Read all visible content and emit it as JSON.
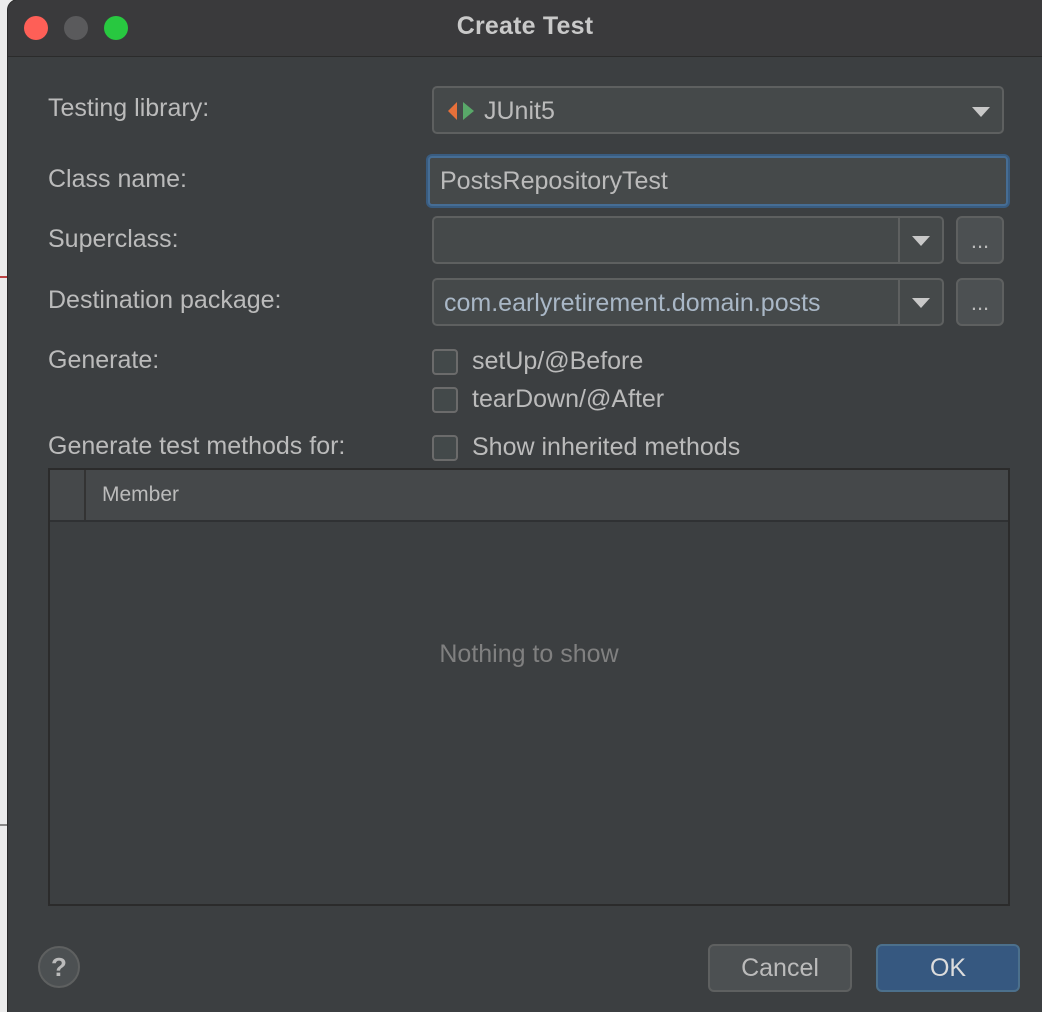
{
  "window": {
    "title": "Create Test"
  },
  "form": {
    "testing_library": {
      "label": "Testing library:",
      "value": "JUnit5",
      "icon": "junit-icon"
    },
    "class_name": {
      "label": "Class name:",
      "value": "PostsRepositoryTest"
    },
    "superclass": {
      "label": "Superclass:",
      "value": "",
      "browse_label": "..."
    },
    "destination_package": {
      "label": "Destination package:",
      "value": "com.earlyretirement.domain.posts",
      "browse_label": "..."
    },
    "generate": {
      "label": "Generate:",
      "options": [
        {
          "label": "setUp/@Before",
          "checked": false
        },
        {
          "label": "tearDown/@After",
          "checked": false
        }
      ]
    },
    "methods": {
      "label": "Generate test methods for:",
      "show_inherited": {
        "label": "Show inherited methods",
        "checked": false
      }
    }
  },
  "table": {
    "column_member": "Member",
    "empty_text": "Nothing to show"
  },
  "footer": {
    "help_label": "?",
    "cancel_label": "Cancel",
    "ok_label": "OK"
  },
  "colors": {
    "background": "#3c3f41",
    "text": "#bbbbbb",
    "accent": "#365880",
    "focus_border": "#466d94",
    "close": "#fe5f57",
    "maximize": "#28c840",
    "junit_orange": "#e7703a",
    "junit_green": "#59a869"
  }
}
